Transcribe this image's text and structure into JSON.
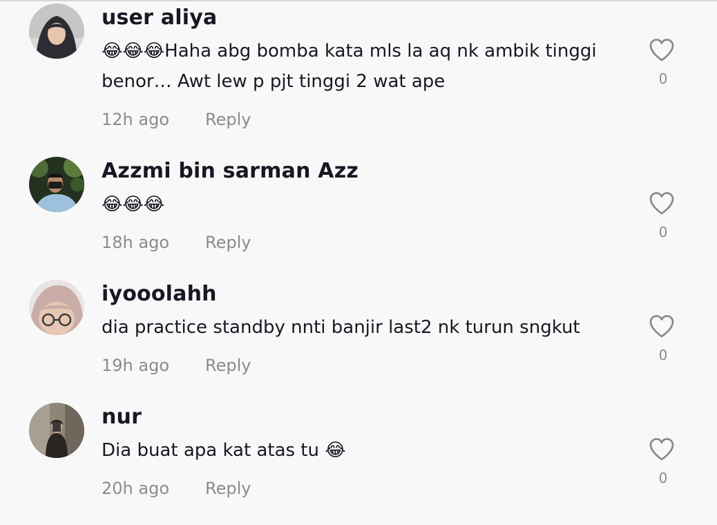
{
  "comments": [
    {
      "username": "user aliya",
      "text": "😂😂😂Haha abg bomba kata mls la aq nk ambik tinggi benor… Awt lew p pjt tinggi 2 wat ape",
      "time": "12h ago",
      "reply_label": "Reply",
      "likes": "0"
    },
    {
      "username": "Azzmi bin sarman Azz",
      "text": "😂😂😂",
      "time": "18h ago",
      "reply_label": "Reply",
      "likes": "0"
    },
    {
      "username": "iyooolahh",
      "text": "dia practice standby nnti banjir last2 nk turun sngkut",
      "time": "19h ago",
      "reply_label": "Reply",
      "likes": "0"
    },
    {
      "username": "nur",
      "text": "Dia buat apa kat atas tu 😂",
      "time": "20h ago",
      "reply_label": "Reply",
      "likes": "0"
    }
  ],
  "icons": {
    "like": "heart-outline-icon"
  },
  "colors": {
    "text_primary": "#161823",
    "text_secondary": "#8a8b91",
    "background": "#f8f8f8"
  }
}
